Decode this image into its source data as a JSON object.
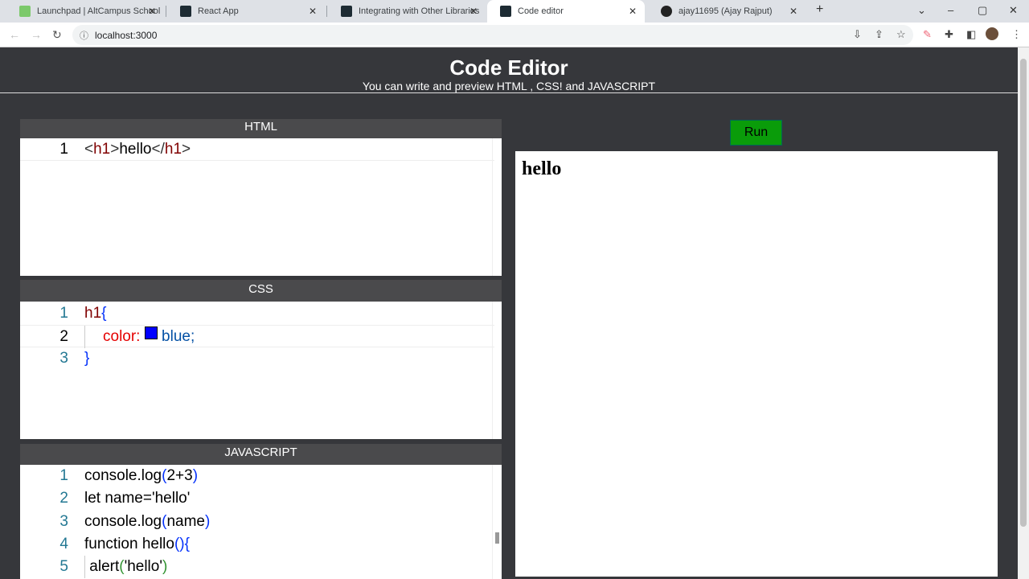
{
  "browser": {
    "tabs": [
      {
        "title": "Launchpad | AltCampus School"
      },
      {
        "title": "React App"
      },
      {
        "title": "Integrating with Other Libraries"
      },
      {
        "title": "Code editor"
      },
      {
        "title": "ajay11695 (Ajay Rajput)"
      }
    ],
    "url": "localhost:3000"
  },
  "header": {
    "title": "Code Editor",
    "subtitle": "You can write and preview HTML , CSS! and JAVASCRIPT"
  },
  "editors": {
    "html_label": "HTML",
    "css_label": "CSS",
    "js_label": "JAVASCRIPT"
  },
  "html_code": {
    "l1a": "<",
    "l1b": "h1",
    ">": ">",
    "l1c": "hello",
    "l1d": "</",
    "l1e": "h1",
    "l1f": ">"
  },
  "css_code": {
    "sel": "h1",
    "ob": "{",
    "prop": "color:",
    "val": "blue;",
    "cb": "}",
    "swatch": "#0000ff"
  },
  "js_code": {
    "l1a": "console.log",
    "l1b": "(",
    "l1c": "2+3",
    "l1d": ")",
    "l2": "let name='hello'",
    "l3a": "console.log",
    "l3b": "(",
    "l3c": "name",
    "l3d": ")",
    "l4a": "function hello",
    "l4b": "(){",
    "l5a": " alert",
    "l5b": "(",
    "l5c": "'hello'",
    "l5d": ")"
  },
  "run_label": "Run",
  "preview": {
    "output": "hello"
  },
  "line_numbers": [
    "1",
    "2",
    "3",
    "4",
    "5"
  ]
}
